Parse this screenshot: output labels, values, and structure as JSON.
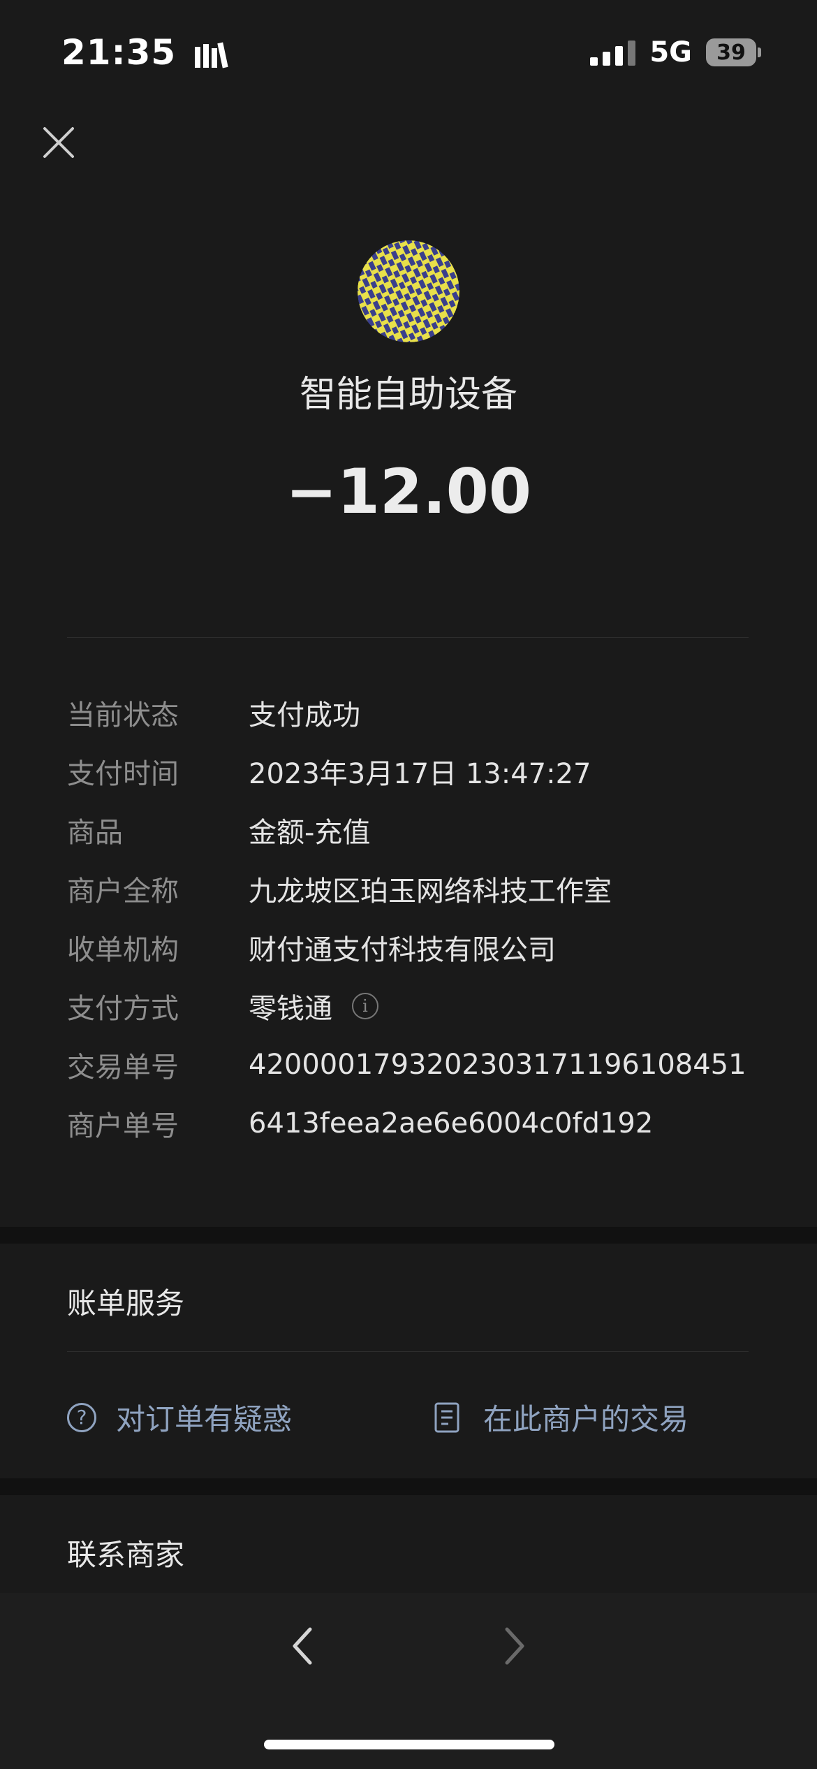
{
  "status_bar": {
    "time": "21:35",
    "network": "5G",
    "battery": "39"
  },
  "header": {
    "merchant_title": "智能自助设备",
    "amount": "−12.00"
  },
  "details": [
    {
      "label": "当前状态",
      "value": "支付成功"
    },
    {
      "label": "支付时间",
      "value": "2023年3月17日 13:47:27"
    },
    {
      "label": "商品",
      "value": "金额-充值"
    },
    {
      "label": "商户全称",
      "value": "九龙坡区珀玉网络科技工作室"
    },
    {
      "label": "收单机构",
      "value": "财付通支付科技有限公司"
    },
    {
      "label": "支付方式",
      "value": "零钱通"
    },
    {
      "label": "交易单号",
      "value": "4200001793202303171196108451"
    },
    {
      "label": "商户单号",
      "value": "6413feea2ae6e6004c0fd192"
    }
  ],
  "bill_service": {
    "title": "账单服务",
    "question_label": "对订单有疑惑",
    "merchant_tx_label": "在此商户的交易"
  },
  "contact": {
    "title": "联系商家"
  },
  "colors": {
    "background": "#1a1a1a",
    "link": "#8fa3c0",
    "avatar_yellow": "#e8e04a",
    "avatar_navy": "#3a3f8c"
  }
}
